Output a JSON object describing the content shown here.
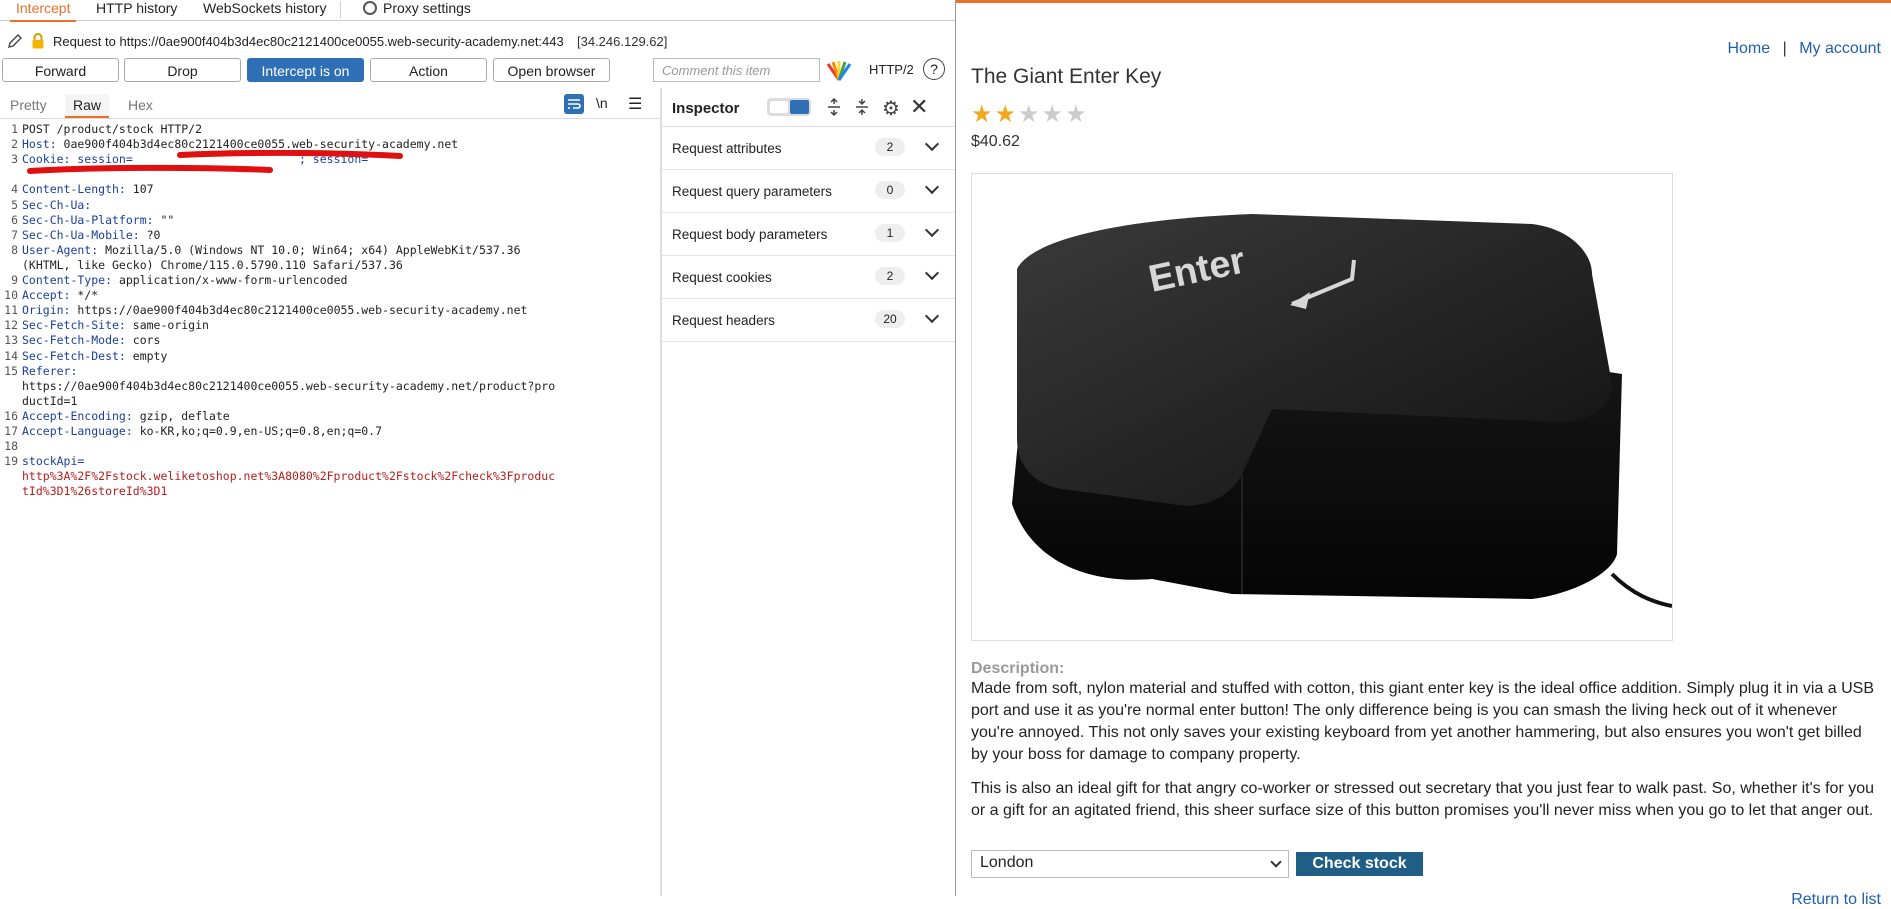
{
  "burp": {
    "tabs": [
      {
        "label": "Intercept",
        "active": true
      },
      {
        "label": "HTTP history"
      },
      {
        "label": "WebSockets history"
      },
      {
        "label": "Proxy settings"
      }
    ],
    "request_target": "Request to https://0ae900f404b3d4ec80c2121400ce0055.web-security-academy.net:443",
    "request_ip": "[34.246.129.62]",
    "toolbar": {
      "forward": "Forward",
      "drop": "Drop",
      "intercept": "Intercept is on",
      "action": "Action",
      "open_browser": "Open browser",
      "comment_placeholder": "Comment this item",
      "protocol": "HTTP/2",
      "help": "?"
    },
    "editor_tabs": [
      "Pretty",
      "Raw",
      "Hex"
    ],
    "editor_icons": {
      "newline": "\\n"
    },
    "request_lines": [
      {
        "num": "1",
        "header": "",
        "value": "POST /product/stock HTTP/2"
      },
      {
        "num": "2",
        "header": "Host:",
        "value": " 0ae900f404b3d4ec80c2121400ce0055.web-security-academy.net"
      },
      {
        "num": "3",
        "header": "Cookie: session=",
        "value": "; session=",
        "redacted": true
      },
      {
        "num": "",
        "header": "",
        "value": ""
      },
      {
        "num": "4",
        "header": "Content-Length:",
        "value": " 107"
      },
      {
        "num": "5",
        "header": "Sec-Ch-Ua:",
        "value": ""
      },
      {
        "num": "6",
        "header": "Sec-Ch-Ua-Platform:",
        "value": " \"\""
      },
      {
        "num": "7",
        "header": "Sec-Ch-Ua-Mobile:",
        "value": " ?0"
      },
      {
        "num": "8",
        "header": "User-Agent:",
        "value": " Mozilla/5.0 (Windows NT 10.0; Win64; x64) AppleWebKit/537.36"
      },
      {
        "num": "",
        "header": "",
        "value": "(KHTML, like Gecko) Chrome/115.0.5790.110 Safari/537.36"
      },
      {
        "num": "9",
        "header": "Content-Type:",
        "value": " application/x-www-form-urlencoded"
      },
      {
        "num": "10",
        "header": "Accept:",
        "value": " */*"
      },
      {
        "num": "11",
        "header": "Origin:",
        "value": " https://0ae900f404b3d4ec80c2121400ce0055.web-security-academy.net"
      },
      {
        "num": "12",
        "header": "Sec-Fetch-Site:",
        "value": " same-origin"
      },
      {
        "num": "13",
        "header": "Sec-Fetch-Mode:",
        "value": " cors"
      },
      {
        "num": "14",
        "header": "Sec-Fetch-Dest:",
        "value": " empty"
      },
      {
        "num": "15",
        "header": "Referer:",
        "value": ""
      },
      {
        "num": "",
        "header": "",
        "value": "https://0ae900f404b3d4ec80c2121400ce0055.web-security-academy.net/product?pro"
      },
      {
        "num": "",
        "header": "",
        "value": "ductId=1"
      },
      {
        "num": "16",
        "header": "Accept-Encoding:",
        "value": " gzip, deflate"
      },
      {
        "num": "17",
        "header": "Accept-Language:",
        "value": " ko-KR,ko;q=0.9,en-US;q=0.8,en;q=0.7"
      },
      {
        "num": "18",
        "header": "",
        "value": ""
      },
      {
        "num": "19",
        "header": "stockApi=",
        "value": ""
      },
      {
        "num": "",
        "header": "",
        "value": "http%3A%2F%2Fstock.weliketoshop.net%3A8080%2Fproduct%2Fstock%2Fcheck%3Fproduc",
        "red": true
      },
      {
        "num": "",
        "header": "",
        "value": "tId%3D1%26storeId%3D1",
        "red": true
      }
    ],
    "inspector": {
      "title": "Inspector",
      "rows": [
        {
          "label": "Request attributes",
          "count": "2"
        },
        {
          "label": "Request query parameters",
          "count": "0"
        },
        {
          "label": "Request body parameters",
          "count": "1"
        },
        {
          "label": "Request cookies",
          "count": "2"
        },
        {
          "label": "Request headers",
          "count": "20"
        }
      ]
    }
  },
  "site": {
    "nav": {
      "home": "Home",
      "separator": "|",
      "account": "My account"
    },
    "title": "The Giant Enter Key",
    "rating": 2,
    "rating_max": 5,
    "price": "$40.62",
    "image_key_text": "Enter",
    "description_heading": "Description:",
    "description_1": "Made from soft, nylon material and stuffed with cotton, this giant enter key is the ideal office addition. Simply plug it in via a USB port and use it as you're normal enter button! The only difference being is you can smash the living heck out of it whenever you're annoyed. This not only saves your existing keyboard from yet another hammering, but also ensures you won't get billed by your boss for damage to company property.",
    "description_2": "This is also an ideal gift for that angry co-worker or stressed out secretary that you just fear to walk past. So, whether it's for you or a gift for an agitated friend, this sheer surface size of this button promises you'll never miss when you go to let that anger out.",
    "store_selected": "London",
    "check_stock": "Check stock",
    "return_link": "Return to list",
    "colors": {
      "accent": "#e8702a",
      "link": "#1f5fb0",
      "button": "#1f5f86",
      "star": "#f0a81d"
    }
  }
}
